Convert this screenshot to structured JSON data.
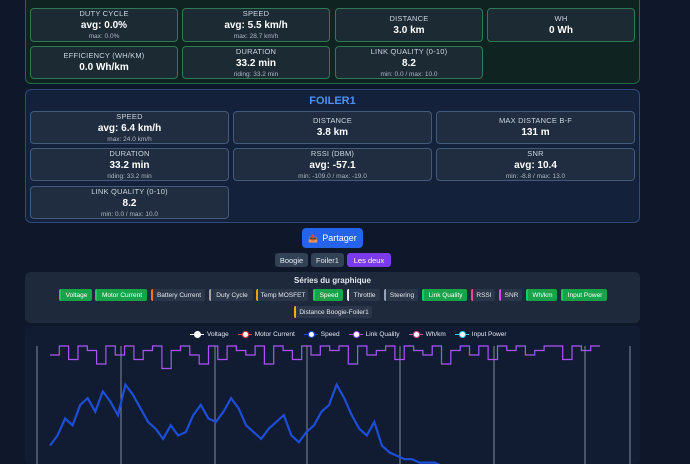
{
  "boogie_stats": [
    {
      "key": "duty_cycle",
      "label": "DUTY CYCLE",
      "value": "avg: 0.0%",
      "sub": "max: 0.0%"
    },
    {
      "key": "speed",
      "label": "SPEED",
      "value": "avg: 5.5 km/h",
      "sub": "max: 28.7 km/h"
    },
    {
      "key": "distance",
      "label": "DISTANCE",
      "value": "3.0 km",
      "sub": ""
    },
    {
      "key": "wh",
      "label": "WH",
      "value": "0 Wh",
      "sub": ""
    },
    {
      "key": "efficiency",
      "label": "EFFICIENCY (WH/KM)",
      "value": "0.0 Wh/km",
      "sub": ""
    },
    {
      "key": "duration",
      "label": "DURATION",
      "value": "33.2 min",
      "sub": "riding: 33.2 min"
    },
    {
      "key": "link_quality",
      "label": "LINK QUALITY (0-10)",
      "value": "8.2",
      "sub": "min: 0.0 / max: 10.0"
    }
  ],
  "foiler": {
    "title": "FOILER1",
    "stats": [
      {
        "key": "speed",
        "label": "SPEED",
        "value": "avg: 6.4 km/h",
        "sub": "max: 24.0 km/h"
      },
      {
        "key": "distance",
        "label": "DISTANCE",
        "value": "3.8 km",
        "sub": ""
      },
      {
        "key": "max_distance",
        "label": "MAX DISTANCE B-F",
        "value": "131 m",
        "sub": ""
      },
      {
        "key": "duration",
        "label": "DURATION",
        "value": "33.2 min",
        "sub": "riding: 33.2 min"
      },
      {
        "key": "rssi",
        "label": "RSSI (DBM)",
        "value": "avg: -57.1",
        "sub": "min: -109.0 / max: -19.0"
      },
      {
        "key": "snr",
        "label": "SNR",
        "value": "avg: 10.4",
        "sub": "min: -8.8 / max: 13.0"
      },
      {
        "key": "link_quality",
        "label": "LINK QUALITY (0-10)",
        "value": "8.2",
        "sub": "min: 0.0 / max: 10.0"
      }
    ]
  },
  "share_button": {
    "label": "Partager",
    "icon": "share-tray-icon"
  },
  "view_toggle": {
    "boogie": "Boogie",
    "foiler": "Foiler1",
    "both": "Les deux",
    "selected": "both"
  },
  "series_panel": {
    "title": "Séries du graphique",
    "chips": [
      {
        "label": "Voltage",
        "active": true,
        "color": "#22c55e"
      },
      {
        "label": "Motor Current",
        "active": true,
        "color": "#ef4444"
      },
      {
        "label": "Battery Current",
        "active": false,
        "color": "#f97316"
      },
      {
        "label": "Duty Cycle",
        "active": false,
        "color": "#a3a3a3"
      },
      {
        "label": "Temp MOSFET",
        "active": false,
        "color": "#f59e0b"
      },
      {
        "label": "Speed",
        "active": true,
        "color": "#3b82f6"
      },
      {
        "label": "Throttle",
        "active": false,
        "color": "#e5e7eb"
      },
      {
        "label": "Steering",
        "active": false,
        "color": "#94a3b8"
      },
      {
        "label": "Link Quality",
        "active": true,
        "color": "#a855f7"
      },
      {
        "label": "RSSI",
        "active": false,
        "color": "#ec4899"
      },
      {
        "label": "SNR",
        "active": false,
        "color": "#d946ef"
      },
      {
        "label": "Wh/km",
        "active": true,
        "color": "#f472b6"
      },
      {
        "label": "Input Power",
        "active": true,
        "color": "#22d3ee"
      },
      {
        "label": "Distance Boogie-Foiler1",
        "active": false,
        "color": "#eab308"
      }
    ]
  },
  "chart_legend": [
    {
      "name": "Voltage",
      "color": "#ffffff"
    },
    {
      "name": "Motor Current",
      "color": "#ef4444"
    },
    {
      "name": "Speed",
      "color": "#1d4ed8"
    },
    {
      "name": "Link Quality",
      "color": "#a855f7"
    },
    {
      "name": "Wh/km",
      "color": "#ec4899"
    },
    {
      "name": "Input Power",
      "color": "#22d3ee"
    }
  ],
  "chart_data": {
    "type": "line",
    "xlabel": "",
    "ylabel": "",
    "series": [
      {
        "name": "Link Quality",
        "color": "#a855f7",
        "values": [
          8,
          10,
          7,
          10,
          9,
          6,
          10,
          8,
          10,
          7,
          9,
          10,
          5,
          9,
          10,
          8,
          6,
          10,
          7,
          10,
          9,
          8,
          10,
          6,
          10,
          9,
          7,
          10,
          8,
          10,
          9,
          10,
          6,
          10,
          8,
          9,
          10,
          7,
          10,
          9,
          8,
          10,
          6,
          9,
          10,
          8,
          10,
          7,
          10,
          9,
          10,
          8,
          9,
          10,
          10,
          7,
          10,
          9,
          10,
          10
        ]
      },
      {
        "name": "Speed",
        "color": "#1d4ed8",
        "values": [
          6,
          9,
          14,
          12,
          18,
          20,
          16,
          22,
          19,
          15,
          24,
          21,
          17,
          13,
          11,
          8,
          12,
          9,
          10,
          15,
          18,
          14,
          13,
          16,
          20,
          17,
          12,
          10,
          8,
          11,
          13,
          15,
          9,
          7,
          10,
          12,
          16,
          18,
          24,
          20,
          15,
          11,
          9,
          13,
          6,
          4,
          3,
          2,
          2,
          1,
          1,
          1,
          0,
          0,
          0,
          0,
          0,
          0,
          0,
          0
        ]
      }
    ]
  }
}
